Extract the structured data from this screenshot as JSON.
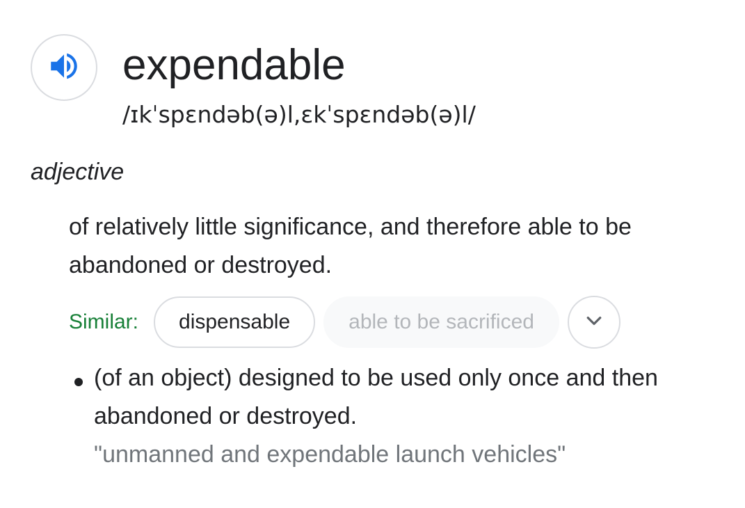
{
  "entry": {
    "word": "expendable",
    "phonetic": "/ɪkˈspɛndəb(ə)l,ɛkˈspɛndəb(ə)l/",
    "speaker_icon": "volume-icon",
    "part_of_speech": "adjective"
  },
  "definition": {
    "text": "of relatively little significance, and therefore able to be abandoned or destroyed."
  },
  "similar": {
    "label": "Similar:",
    "chips": [
      "dispensable",
      "able to be sacrificed"
    ],
    "expand_icon": "chevron-down-icon"
  },
  "sense": {
    "definition": "(of an object) designed to be used only once and then abandoned or destroyed.",
    "example": "\"unmanned and expendable launch vehicles\""
  },
  "colors": {
    "accent_blue": "#1a73e8",
    "similar_green": "#188038",
    "text": "#202124",
    "muted": "#70757a"
  }
}
